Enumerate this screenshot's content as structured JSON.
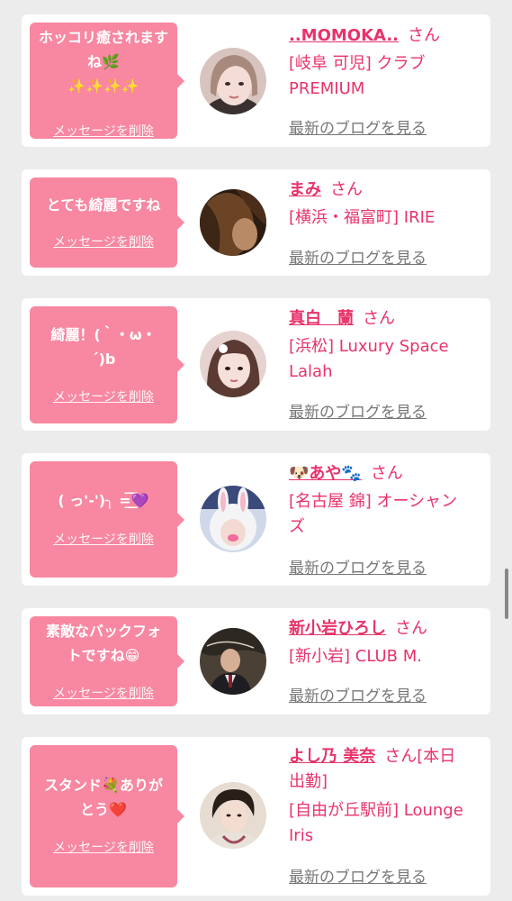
{
  "messages": [
    {
      "bubble_text": "ホッコリ癒されますね🌿\n✨✨✨✨",
      "delete_label": "メッセージを削除",
      "name": "..MOMOKA..",
      "honorific": "さん",
      "shop": "[岐阜 可児] クラブ\nPREMIUM",
      "blog_label": "最新のブログを見る"
    },
    {
      "bubble_text": "とても綺麗ですね",
      "delete_label": "メッセージを削除",
      "name": "まみ",
      "honorific": "さん",
      "shop": "[横浜・福富町] IRIE",
      "blog_label": "最新のブログを見る"
    },
    {
      "bubble_text": "綺麗！(｀・ω・\n´)b",
      "delete_label": "メッセージを削除",
      "name": "真白　蘭",
      "honorific": "さん",
      "shop": "[浜松] Luxury Space\nLalah",
      "blog_label": "最新のブログを見る"
    },
    {
      "bubble_text": "( っ'-')╮ =͟͟͞💜",
      "delete_label": "メッセージを削除",
      "name": "🐶あや🐾",
      "honorific": "さん",
      "shop": "[名古屋 錦] オーシャン\nズ",
      "blog_label": "最新のブログを見る"
    },
    {
      "bubble_text": "素敵なバックフォ\nトですね😁",
      "delete_label": "メッセージを削除",
      "name": "新小岩ひろし",
      "honorific": "さん",
      "shop": "[新小岩] CLUB M.",
      "blog_label": "最新のブログを見る"
    },
    {
      "bubble_text": "スタンド💐ありが\nとう❤️",
      "delete_label": "メッセージを削除",
      "name": "よし乃 美奈",
      "honorific": "さん[本日\n出勤]",
      "shop": "[自由が丘駅前] Lounge\nIris",
      "blog_label": "最新のブログを見る"
    }
  ],
  "colors": {
    "bubble": "#f887a1",
    "accent": "#e8336a",
    "muted_link": "#777777",
    "page_background": "#ececec"
  }
}
